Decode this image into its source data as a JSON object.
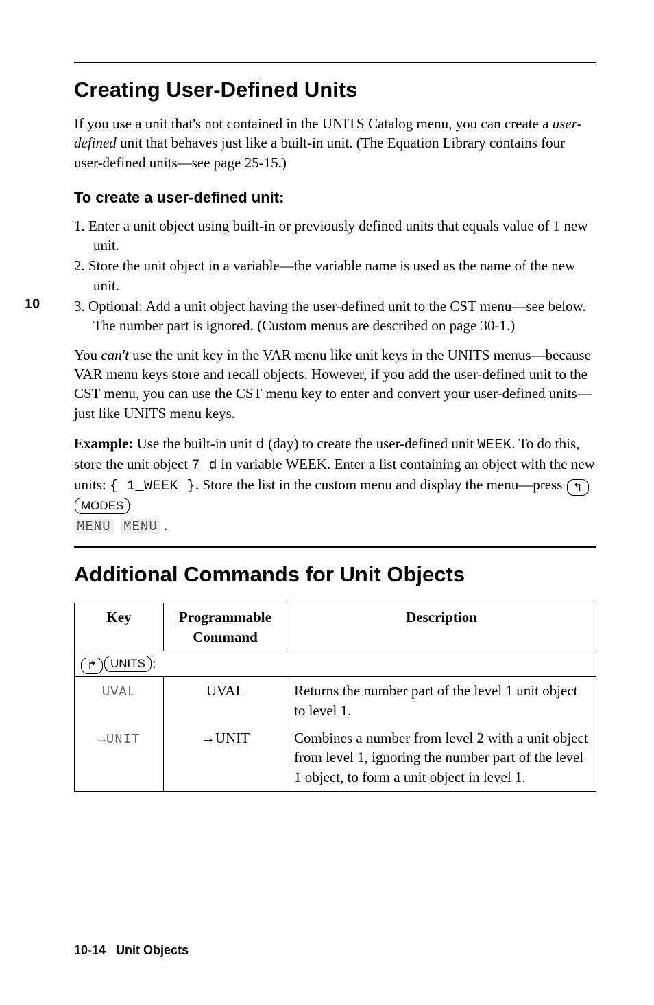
{
  "margin_number": "10",
  "section1": {
    "title": "Creating User-Defined Units",
    "intro_prefix": "If you use a unit that's not contained in the UNITS Catalog menu, you can create a ",
    "intro_em": "user-defined",
    "intro_suffix": " unit that behaves just like a built-in unit. (The Equation Library contains four user-defined units—see page 25-15.)",
    "subheading": "To create a user-defined unit:",
    "steps": [
      "1.  Enter a unit object using built-in or previously defined units that equals value of 1 new unit.",
      "2.  Store the unit object in a variable—the variable name is used as the name of the new unit.",
      "3.  Optional: Add a unit object having the user-defined unit to the CST menu—see below. The number part is ignored. (Custom menus are described on page 30-1.)"
    ],
    "para2_prefix": "You ",
    "para2_em": "can't",
    "para2_suffix": " use the unit key in the VAR menu like unit keys in the UNITS menus—because VAR menu keys store and recall objects. However, if you add the user-defined unit to the CST menu, you can use the CST menu key to enter and convert your user-defined units—just like UNITS menu keys.",
    "example_label": "Example:",
    "example_a": " Use the built-in unit ",
    "example_mono1": "d",
    "example_b": " (day) to create the user-defined unit ",
    "example_mono2": "WEEK",
    "example_c": ". To do this, store the unit object ",
    "example_mono3": "7_d",
    "example_d": " in variable WEEK. Enter a list containing an object with the new units: ",
    "example_mono4": "{ 1_WEEK }",
    "example_e": ". Store the list in the custom menu and display the menu—press ",
    "key_left": "↰",
    "key_modes": "MODES",
    "softkey1": "MENU",
    "softkey2": "MENU",
    "example_end": " ."
  },
  "section2": {
    "title": "Additional Commands for Unit Objects",
    "table": {
      "headers": [
        "Key",
        "Programmable Command",
        "Description"
      ],
      "group_key_right": "↱",
      "group_key_label": "UNITS",
      "group_suffix": ":",
      "rows": [
        {
          "key": "UVAL",
          "cmd": "UVAL",
          "desc": "Returns the number part of the level 1 unit object to level 1."
        },
        {
          "key": "→UNIT",
          "cmd": "→UNIT",
          "desc": "Combines a number from level 2 with a unit object from level 1, ignoring the number part of the level 1 object, to form a unit object in level 1."
        }
      ]
    }
  },
  "footer": {
    "page": "10-14",
    "label": "Unit Objects"
  }
}
